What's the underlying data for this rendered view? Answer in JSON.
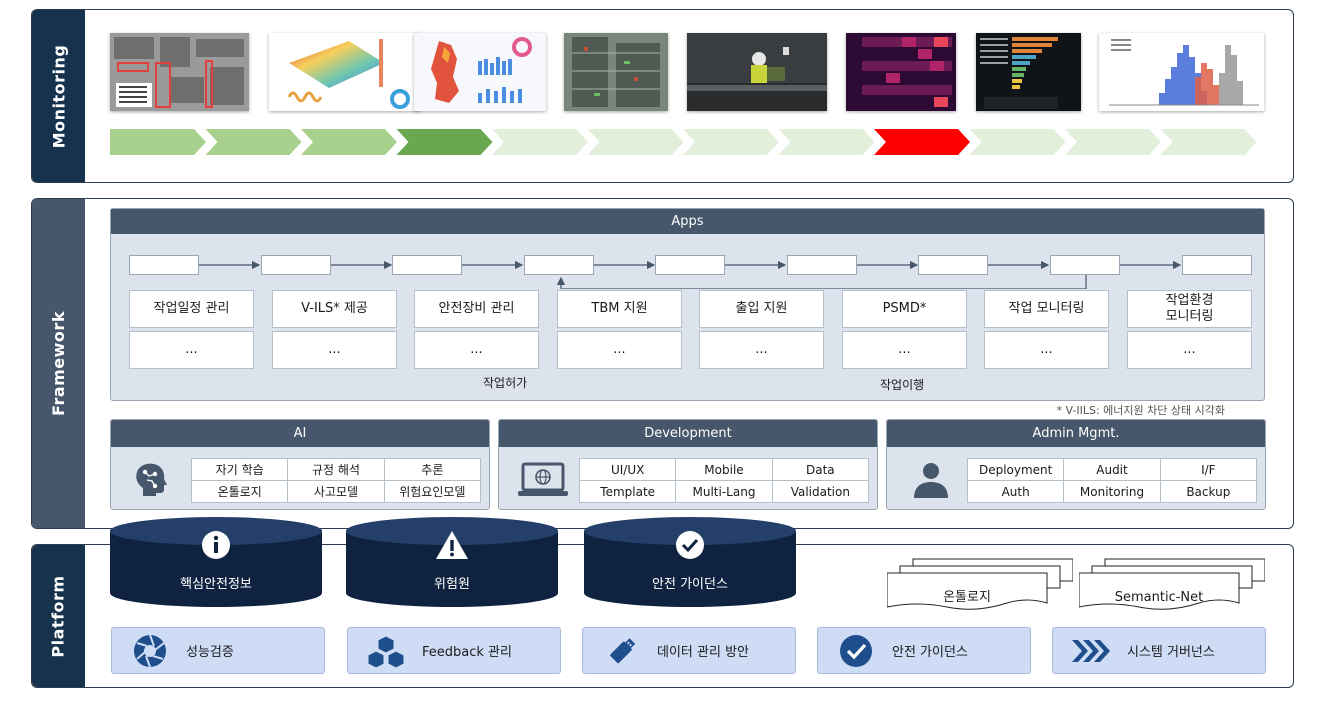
{
  "monitoring": {
    "label": "Monitoring"
  },
  "framework": {
    "label": "Framework",
    "apps_title": "Apps",
    "apps": [
      "작업일정 관리",
      "V-ILS* 제공",
      "안전장비 관리",
      "TBM 지원",
      "출입 지원",
      "PSMD*",
      "작업 모니터링",
      "작업환경\n모니터링"
    ],
    "ellipsis": "...",
    "phase_permit": "작업허가",
    "phase_execute": "작업이행",
    "note": "* V-IILS: 에너지원 차단 상태 시각화",
    "ai": {
      "title": "AI",
      "items": [
        "자기 학습",
        "규정 해석",
        "추론",
        "온톨로지",
        "사고모델",
        "위험요인모델"
      ]
    },
    "development": {
      "title": "Development",
      "items": [
        "UI/UX",
        "Mobile",
        "Data",
        "Template",
        "Multi-Lang",
        "Validation"
      ]
    },
    "admin": {
      "title": "Admin Mgmt.",
      "items": [
        "Deployment",
        "Audit",
        "I/F",
        "Auth",
        "Monitoring",
        "Backup"
      ]
    }
  },
  "platform": {
    "label": "Platform",
    "databases": [
      "핵심안전정보",
      "위험원",
      "안전 가이던스"
    ],
    "documents": [
      "온톨로지",
      "Semantic-Net"
    ],
    "buttons": [
      "성능검증",
      "Feedback 관리",
      "데이터 관리 방안",
      "안전 가이던스",
      "시스템 거버넌스"
    ]
  },
  "colors": {
    "navy": "#17324d",
    "slate": "#46566b",
    "chevron_done": "#a9d18e",
    "chevron_active": "#6aa84f",
    "chevron_pending": "#e2efda",
    "chevron_alert": "#ff0000"
  }
}
